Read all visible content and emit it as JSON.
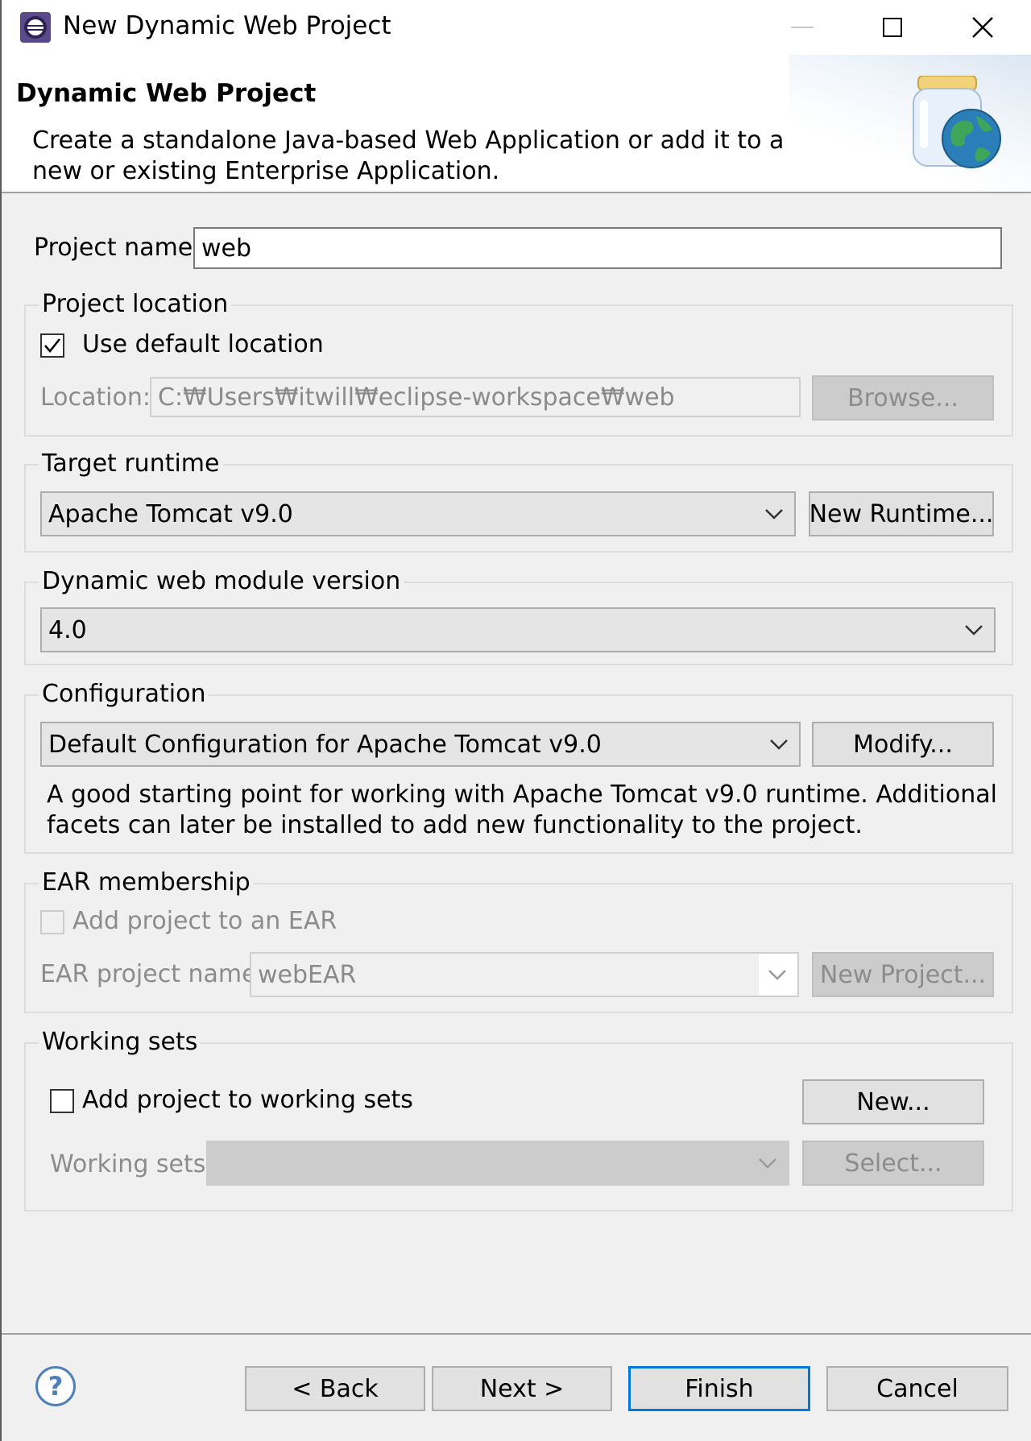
{
  "window": {
    "title": "New Dynamic Web Project"
  },
  "banner": {
    "title": "Dynamic Web Project",
    "description": "Create a standalone Java-based Web Application or add it to a new or existing Enterprise Application."
  },
  "project_name": {
    "label": "Project name:",
    "value": "web"
  },
  "project_location": {
    "group_title": "Project location",
    "use_default_label": "Use default location",
    "use_default_checked": true,
    "location_label": "Location:",
    "location_value": "C:₩Users₩itwill₩eclipse-workspace₩web",
    "browse_label": "Browse..."
  },
  "target_runtime": {
    "group_title": "Target runtime",
    "selected": "Apache Tomcat v9.0",
    "new_runtime_label": "New Runtime..."
  },
  "module_version": {
    "group_title": "Dynamic web module version",
    "selected": "4.0"
  },
  "configuration": {
    "group_title": "Configuration",
    "selected": "Default Configuration for Apache Tomcat v9.0",
    "modify_label": "Modify...",
    "description": "A good starting point for working with Apache Tomcat v9.0 runtime. Additional facets can later be installed to add new functionality to the project."
  },
  "ear_membership": {
    "group_title": "EAR membership",
    "add_to_ear_label": "Add project to an EAR",
    "add_to_ear_checked": false,
    "ear_name_label": "EAR project name:",
    "ear_name_value": "webEAR",
    "new_project_label": "New Project..."
  },
  "working_sets": {
    "group_title": "Working sets",
    "add_label": "Add project to working sets",
    "add_checked": false,
    "new_label": "New...",
    "sets_label": "Working sets:",
    "sets_value": "",
    "select_label": "Select..."
  },
  "footer": {
    "help_symbol": "?",
    "back_label": "< Back",
    "next_label": "Next >",
    "finish_label": "Finish",
    "cancel_label": "Cancel"
  },
  "colors": {
    "accent_default_button": "#0078d7",
    "help_icon": "#4d7fb8"
  }
}
